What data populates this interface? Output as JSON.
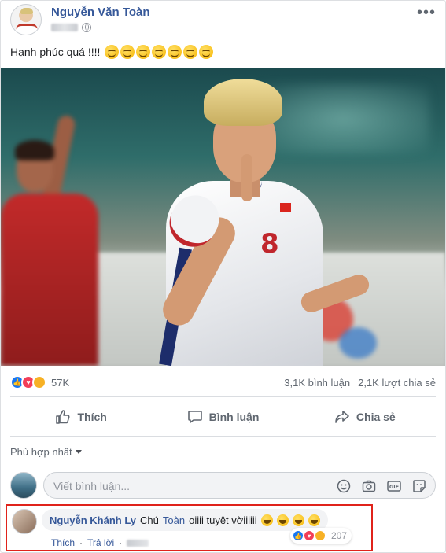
{
  "post": {
    "author": "Nguyễn Văn Toàn",
    "text": "Hạnh phúc quá !!!!",
    "smile_emojis": [
      "smile-emoji",
      "smile-emoji",
      "smile-emoji",
      "smile-emoji",
      "smile-emoji",
      "smile-emoji",
      "smile-emoji"
    ],
    "player_number": "8"
  },
  "summary": {
    "reactions": [
      "like",
      "love",
      "haha"
    ],
    "reaction_count": "57K",
    "comments": "3,1K bình luận",
    "shares": "2,1K lượt chia sẻ"
  },
  "actions": {
    "like": "Thích",
    "comment": "Bình luận",
    "share": "Chia sẻ"
  },
  "sort": {
    "label": "Phù hợp nhất"
  },
  "composer": {
    "placeholder": "Viết bình luận..."
  },
  "comment": {
    "name": "Nguyễn Khánh Ly",
    "text_before": "Chú",
    "mention": "Toàn",
    "text_after": "oiiii tuyệt vờiiiiii",
    "reaction_count": "207",
    "like_label": "Thích",
    "reply_label": "Trả lời",
    "separator": "·"
  },
  "colors": {
    "link": "#365899",
    "like": "#1877f2",
    "love": "#f33e58",
    "haha": "#f7b125",
    "highlight_border": "#e0231b"
  }
}
